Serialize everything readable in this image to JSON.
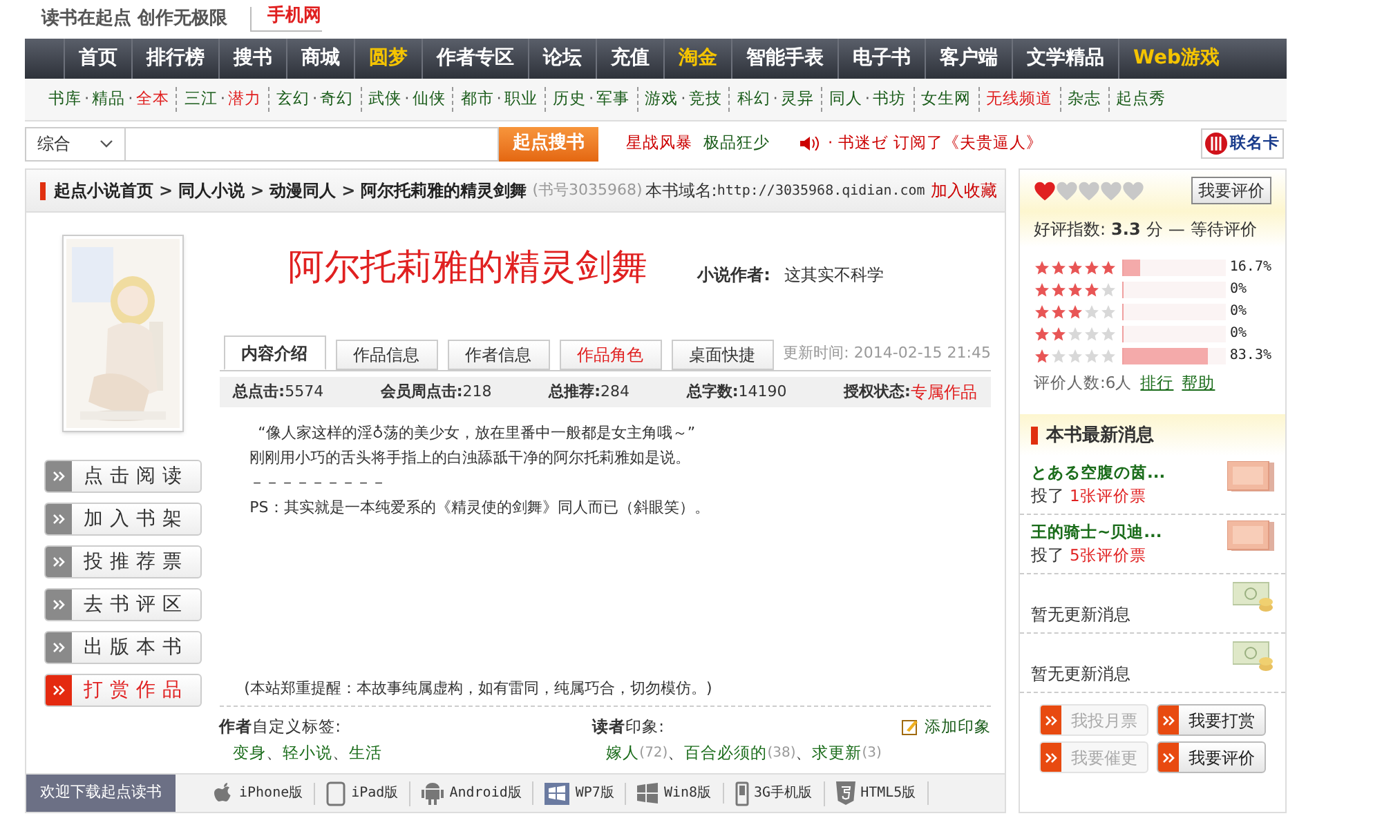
{
  "header": {
    "slogan": "读书在起点 创作无极限",
    "mobile_link": "手机网"
  },
  "nav": [
    {
      "label": "首页",
      "highlight": false
    },
    {
      "label": "排行榜",
      "highlight": false
    },
    {
      "label": "搜书",
      "highlight": false
    },
    {
      "label": "商城",
      "highlight": false
    },
    {
      "label": "圆梦",
      "highlight": true
    },
    {
      "label": "作者专区",
      "highlight": false
    },
    {
      "label": "论坛",
      "highlight": false
    },
    {
      "label": "充值",
      "highlight": false
    },
    {
      "label": "淘金",
      "highlight": true
    },
    {
      "label": "智能手表",
      "highlight": false
    },
    {
      "label": "电子书",
      "highlight": false
    },
    {
      "label": "客户端",
      "highlight": false
    },
    {
      "label": "文学精品",
      "highlight": false
    },
    {
      "label": "Web游戏",
      "highlight": true
    }
  ],
  "subnav_separator": "·",
  "subnav": [
    [
      {
        "label": "书库",
        "highlight": false
      },
      {
        "label": "精品",
        "highlight": false
      },
      {
        "label": "全本",
        "highlight": true
      }
    ],
    [
      {
        "label": "三江",
        "highlight": false
      },
      {
        "label": "潜力",
        "highlight": true
      }
    ],
    [
      {
        "label": "玄幻",
        "highlight": false
      },
      {
        "label": "奇幻",
        "highlight": false
      }
    ],
    [
      {
        "label": "武侠",
        "highlight": false
      },
      {
        "label": "仙侠",
        "highlight": false
      }
    ],
    [
      {
        "label": "都市",
        "highlight": false
      },
      {
        "label": "职业",
        "highlight": false
      }
    ],
    [
      {
        "label": "历史",
        "highlight": false
      },
      {
        "label": "军事",
        "highlight": false
      }
    ],
    [
      {
        "label": "游戏",
        "highlight": false
      },
      {
        "label": "竞技",
        "highlight": false
      }
    ],
    [
      {
        "label": "科幻",
        "highlight": false
      },
      {
        "label": "灵异",
        "highlight": false
      }
    ],
    [
      {
        "label": "同人",
        "highlight": false
      },
      {
        "label": "书坊",
        "highlight": false
      }
    ],
    [
      {
        "label": "女生网",
        "highlight": false
      }
    ],
    [
      {
        "label": "无线频道",
        "highlight": true
      }
    ],
    [
      {
        "label": "杂志",
        "highlight": false
      }
    ],
    [
      {
        "label": "起点秀",
        "highlight": false
      }
    ]
  ],
  "search": {
    "category": "综合",
    "button": "起点搜书",
    "hot_links": [
      "星战风暴",
      "极品狂少"
    ],
    "ticker_user": "· 书迷ゼ",
    "ticker_text": "订阅了《夫贵逼人》",
    "card_link": "联名卡"
  },
  "breadcrumb": {
    "separator": ">",
    "items": [
      "起点小说首页",
      "同人小说",
      "动漫同人",
      "阿尔托莉雅的精灵剑舞"
    ],
    "book_no": "(书号3035968)",
    "domain_label": "本书域名:",
    "domain": "http://3035968.qidian.com",
    "favorite": "加入收藏"
  },
  "book": {
    "title": "阿尔托莉雅的精灵剑舞",
    "author_label": "小说作者:",
    "author": "这其实不科学"
  },
  "actions": [
    {
      "label": "点击阅读",
      "kind": "normal"
    },
    {
      "label": "加入书架",
      "kind": "normal"
    },
    {
      "label": "投推荐票",
      "kind": "normal"
    },
    {
      "label": "去书评区",
      "kind": "normal"
    },
    {
      "label": "出版本书",
      "kind": "normal"
    },
    {
      "label": "打赏作品",
      "kind": "reward"
    }
  ],
  "tabs": [
    {
      "label": "内容介绍",
      "selected": true,
      "highlight": false
    },
    {
      "label": "作品信息",
      "selected": false,
      "highlight": false
    },
    {
      "label": "作者信息",
      "selected": false,
      "highlight": false
    },
    {
      "label": "作品角色",
      "selected": false,
      "highlight": true
    },
    {
      "label": "桌面快捷",
      "selected": false,
      "highlight": false
    }
  ],
  "updated": "更新时间: 2014-02-15 21:45",
  "stats": [
    {
      "label": "总点击:",
      "value": "5574",
      "highlight": false
    },
    {
      "label": "会员周点击:",
      "value": "218",
      "highlight": false
    },
    {
      "label": "总推荐:",
      "value": "284",
      "highlight": false
    },
    {
      "label": "总字数:",
      "value": "14190",
      "highlight": false
    },
    {
      "label": "授权状态:",
      "value": "专属作品",
      "highlight": true
    }
  ],
  "intro": [
    "“像人家这样的淫♁荡的美少女，放在里番中一般都是女主角哦～”",
    "刚刚用小巧的舌头将手指上的白浊舔舐干净的阿尔托莉雅如是说。",
    "－－－－－－－－－",
    "PS：其实就是一本纯爱系的《精灵使的剑舞》同人而已（斜眼笑）。"
  ],
  "disclaimer": "(本站郑重提醒：本故事纯属虚构，如有雷同，纯属巧合，切勿模仿。)",
  "author_tags": {
    "separator": "、",
    "title": "**作者**自定义标签:",
    "tags": [
      "变身",
      "轻小说",
      "生活"
    ]
  },
  "impressions": {
    "separator": "、",
    "title": "**读者**印象:",
    "add": "添加印象",
    "items": [
      {
        "label": "嫁人",
        "count": "(72)"
      },
      {
        "label": "百合必须的",
        "count": "(38)"
      },
      {
        "label": "求更新",
        "count": "(3)"
      }
    ]
  },
  "download": {
    "label": "欢迎下载起点读书",
    "apps": [
      {
        "label": "iPhone版",
        "kind": "apple"
      },
      {
        "label": "iPad版",
        "kind": "tablet"
      },
      {
        "label": "Android版",
        "kind": "android"
      },
      {
        "label": "WP7版",
        "kind": "wp"
      },
      {
        "label": "Win8版",
        "kind": "win"
      },
      {
        "label": "3G手机版",
        "kind": "phone"
      },
      {
        "label": "HTML5版",
        "kind": "html5"
      }
    ]
  },
  "rating": {
    "stars": 1,
    "button": "我要评价",
    "score_label": "好评指数:",
    "score": "3.3",
    "unit": "分",
    "dash": "—",
    "status": "等待评价",
    "rows": [
      {
        "stars": 5,
        "level": 0.167,
        "reading": "16.7%"
      },
      {
        "stars": 4,
        "level": 0,
        "reading": "0%"
      },
      {
        "stars": 3,
        "level": 0,
        "reading": "0%"
      },
      {
        "stars": 2,
        "level": 0,
        "reading": "0%"
      },
      {
        "stars": 1,
        "level": 0.833,
        "reading": "83.3%"
      }
    ],
    "count": "评价人数:6人",
    "links": [
      "排行",
      "帮助"
    ]
  },
  "news": {
    "title": "本书最新消息",
    "items": [
      {
        "kind": "vote",
        "user": "とある空腹の茵...",
        "verb": "投了",
        "amount": "1张评价票"
      },
      {
        "kind": "vote",
        "user": "王的骑士~贝迪...",
        "verb": "投了",
        "amount": "5张评价票"
      },
      {
        "kind": "empty",
        "text": "暂无更新消息"
      },
      {
        "kind": "empty",
        "text": "暂无更新消息"
      }
    ]
  },
  "side_buttons": [
    {
      "label": "我投月票",
      "disabled": true
    },
    {
      "label": "我要打赏",
      "disabled": false
    },
    {
      "label": "我要催更",
      "disabled": true
    },
    {
      "label": "我要评价",
      "disabled": false
    }
  ]
}
